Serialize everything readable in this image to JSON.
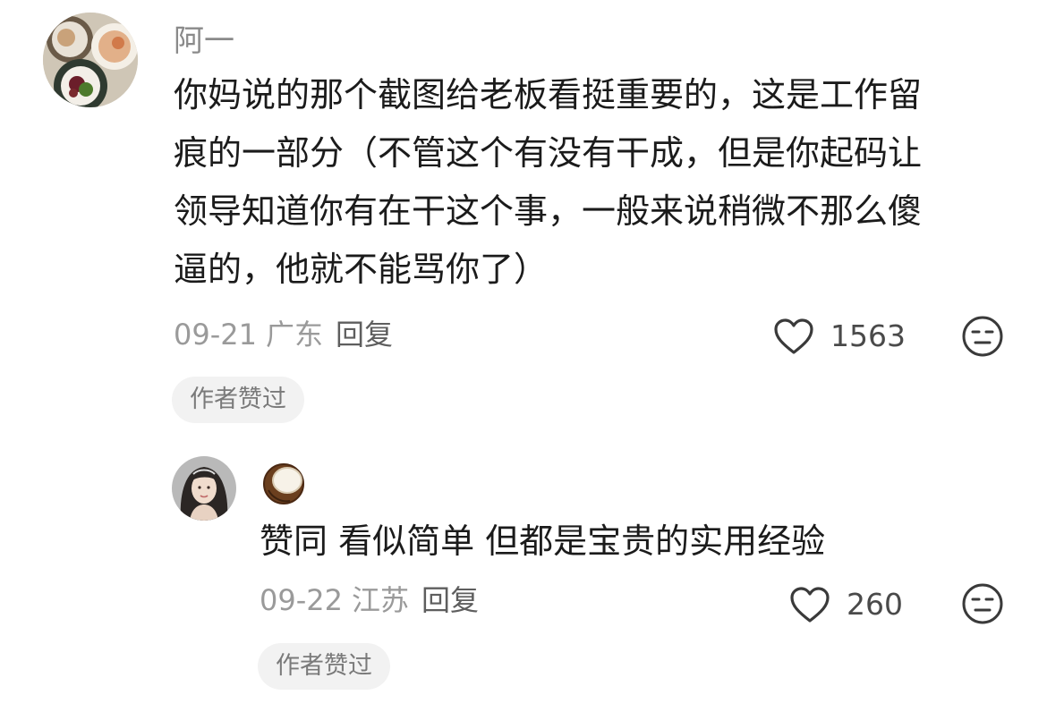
{
  "comments": [
    {
      "username": "阿一",
      "content_lines": [
        "你妈说的那个截图给老板看挺重要的，这是工作留",
        "痕的一部分（不管这个有没有干成，但是你起码让",
        "领导知道你有在干这个事，一般来说稍微不那么傻",
        "逼的，他就不能骂你了）"
      ],
      "date": "09-21",
      "location": "广东",
      "reply_label": "回复",
      "like_count": "1563",
      "author_liked_badge": "作者赞过",
      "avatar_icon": "food-plate-avatar",
      "like_icon": "heart-outline-icon",
      "dislike_icon": "meh-face-icon"
    },
    {
      "username_icon": "coconut-emoji-icon",
      "content_lines": [
        "赞同 看似简单 但都是宝贵的实用经验"
      ],
      "date": "09-22",
      "location": "江苏",
      "reply_label": "回复",
      "like_count": "260",
      "author_liked_badge": "作者赞过",
      "avatar_icon": "girl-portrait-avatar",
      "like_icon": "heart-outline-icon",
      "dislike_icon": "meh-face-icon"
    }
  ],
  "colors": {
    "text": "#1b1b1b",
    "meta": "#9a9a9a",
    "badge_bg": "#f2f2f2",
    "icon": "#3a3a3a"
  }
}
